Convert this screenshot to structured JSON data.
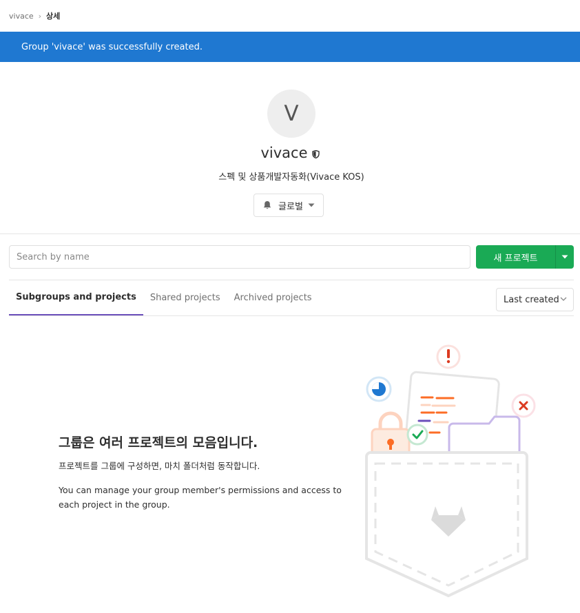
{
  "breadcrumb": {
    "parent": "vivace",
    "separator": "›",
    "current": "상세"
  },
  "flash": {
    "message": "Group 'vivace' was successfully created."
  },
  "group": {
    "avatar_letter": "V",
    "name": "vivace",
    "visibility_icon": "shield-icon",
    "description": "스펙 및 상품개발자동화(Vivace KOS)"
  },
  "notifications": {
    "label": "글로벌",
    "icon": "bell-icon"
  },
  "search": {
    "placeholder": "Search by name",
    "value": ""
  },
  "new_project": {
    "label": "새 프로젝트"
  },
  "tabs": [
    {
      "label": "Subgroups and projects",
      "active": true
    },
    {
      "label": "Shared projects",
      "active": false
    },
    {
      "label": "Archived projects",
      "active": false
    }
  ],
  "sort": {
    "selected": "Last created"
  },
  "empty_state": {
    "title": "그룹은 여러 프로젝트의 모음입니다.",
    "subtitle": "프로젝트를 그룹에 구성하면, 마치 폴더처럼 동작합니다.",
    "body": "You can manage your group member's permissions and access to each project in the group."
  },
  "colors": {
    "flash_bg": "#1f78d1",
    "new_project_bg": "#1aaa55",
    "active_tab_border": "#6b4fbb"
  }
}
